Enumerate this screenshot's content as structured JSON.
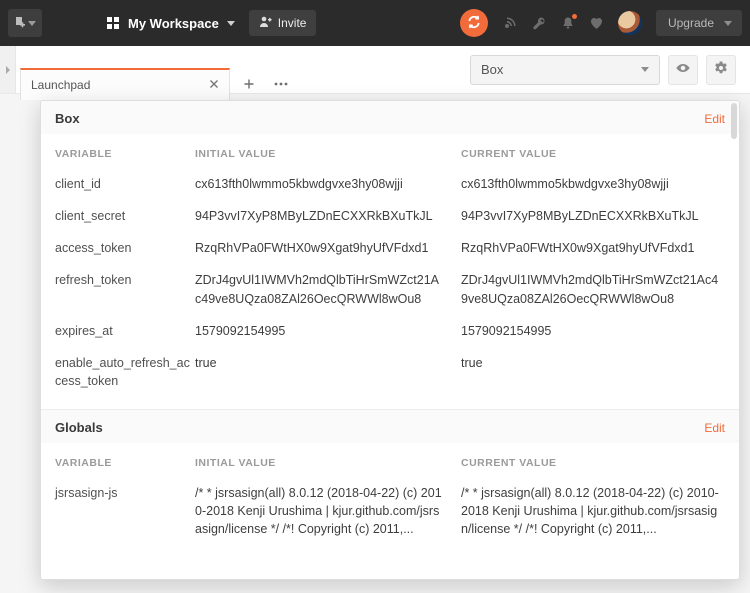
{
  "header": {
    "workspace_label": "My Workspace",
    "invite_label": "Invite",
    "upgrade_label": "Upgrade"
  },
  "env_selector": {
    "selected": "Box"
  },
  "tabs": {
    "active": {
      "label": "Launchpad"
    }
  },
  "popup": {
    "scopes": [
      {
        "title": "Box",
        "edit_label": "Edit",
        "columns": {
          "variable": "VARIABLE",
          "initial": "INITIAL VALUE",
          "current": "CURRENT VALUE"
        },
        "rows": [
          {
            "name": "client_id",
            "initial": "cx613fth0lwmmo5kbwdgvxe3hy08wjji",
            "current": "cx613fth0lwmmo5kbwdgvxe3hy08wjji"
          },
          {
            "name": "client_secret",
            "initial": "94P3vvI7XyP8MByLZDnECXXRkBXuTkJL",
            "current": "94P3vvI7XyP8MByLZDnECXXRkBXuTkJL"
          },
          {
            "name": "access_token",
            "initial": "RzqRhVPa0FWtHX0w9Xgat9hyUfVFdxd1",
            "current": "RzqRhVPa0FWtHX0w9Xgat9hyUfVFdxd1"
          },
          {
            "name": "refresh_token",
            "initial": "ZDrJ4gvUl1IWMVh2mdQlbTiHrSmWZct21Ac49ve8UQza08ZAl26OecQRWWl8wOu8",
            "current": "ZDrJ4gvUl1IWMVh2mdQlbTiHrSmWZct21Ac49ve8UQza08ZAl26OecQRWWl8wOu8"
          },
          {
            "name": "expires_at",
            "initial": "1579092154995",
            "current": "1579092154995"
          },
          {
            "name": "enable_auto_refresh_access_token",
            "initial": "true",
            "current": "true"
          }
        ]
      },
      {
        "title": "Globals",
        "edit_label": "Edit",
        "columns": {
          "variable": "VARIABLE",
          "initial": "INITIAL VALUE",
          "current": "CURRENT VALUE"
        },
        "rows": [
          {
            "name": "jsrsasign-js",
            "initial": "/* * jsrsasign(all) 8.0.12 (2018-04-22) (c) 2010-2018 Kenji Urushima | kjur.github.com/jsrsasign/license */ /*! Copyright (c) 2011,...",
            "current": "/* * jsrsasign(all) 8.0.12 (2018-04-22) (c) 2010-2018 Kenji Urushima | kjur.github.com/jsrsasign/license */ /*! Copyright (c) 2011,..."
          }
        ]
      }
    ]
  }
}
